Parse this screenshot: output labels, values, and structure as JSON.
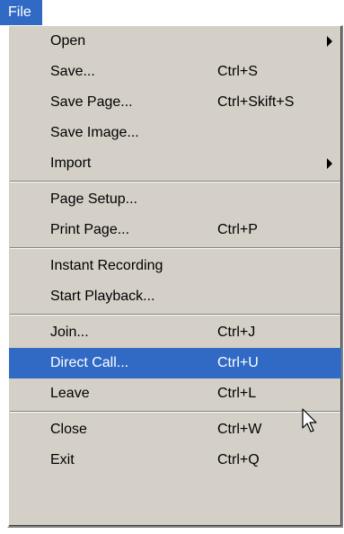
{
  "menu_title": "File",
  "groups": [
    [
      {
        "label": "Open",
        "shortcut": "",
        "submenu": true
      },
      {
        "label": "Save...",
        "shortcut": "Ctrl+S",
        "submenu": false
      },
      {
        "label": "Save Page...",
        "shortcut": "Ctrl+Skift+S",
        "submenu": false
      },
      {
        "label": "Save Image...",
        "shortcut": "",
        "submenu": false
      },
      {
        "label": "Import",
        "shortcut": "",
        "submenu": true
      }
    ],
    [
      {
        "label": "Page Setup...",
        "shortcut": "",
        "submenu": false
      },
      {
        "label": "Print Page...",
        "shortcut": "Ctrl+P",
        "submenu": false
      }
    ],
    [
      {
        "label": "Instant Recording",
        "shortcut": "",
        "submenu": false
      },
      {
        "label": "Start Playback...",
        "shortcut": "",
        "submenu": false
      }
    ],
    [
      {
        "label": "Join...",
        "shortcut": "Ctrl+J",
        "submenu": false
      },
      {
        "label": "Direct Call...",
        "shortcut": "Ctrl+U",
        "submenu": false,
        "highlighted": true
      },
      {
        "label": "Leave",
        "shortcut": "Ctrl+L",
        "submenu": false
      }
    ],
    [
      {
        "label": "Close",
        "shortcut": "Ctrl+W",
        "submenu": false
      },
      {
        "label": "Exit",
        "shortcut": "Ctrl+Q",
        "submenu": false
      }
    ]
  ],
  "colors": {
    "highlight": "#316ac5",
    "menu_bg": "#d4d0c8"
  },
  "icons": {
    "submenu": "triangle-right-icon",
    "cursor": "mouse-pointer-icon"
  }
}
